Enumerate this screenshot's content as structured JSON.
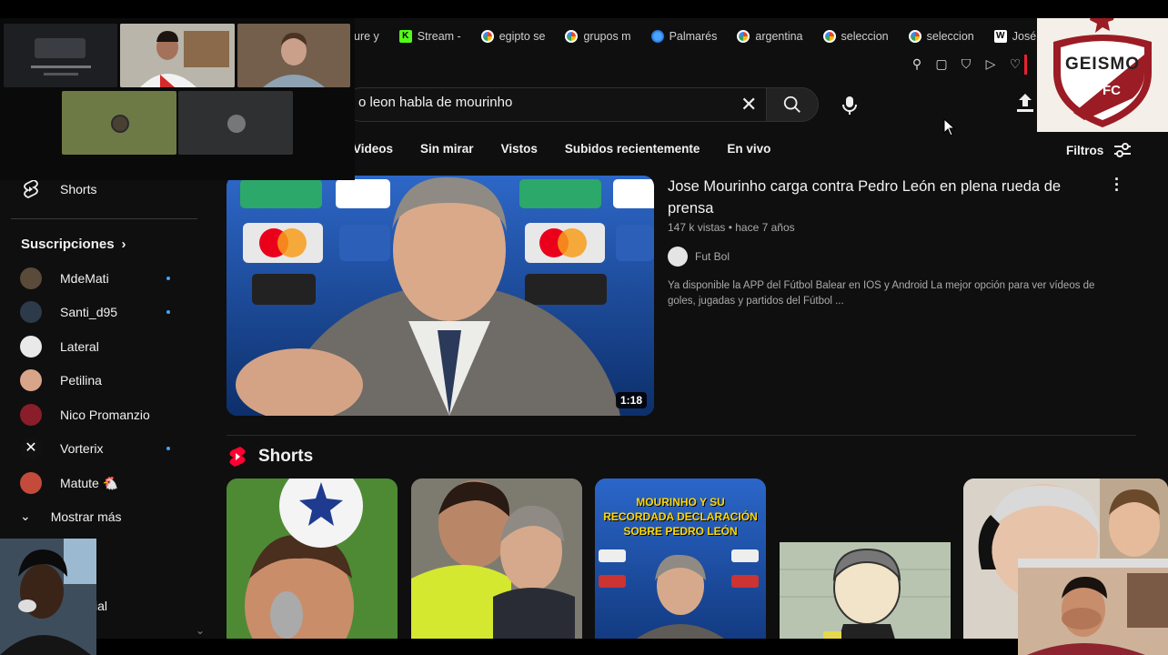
{
  "browser": {
    "tabs": [
      {
        "label": "ure y",
        "icon": "generic-tab-icon"
      },
      {
        "label": "Stream -",
        "icon": "kick-icon"
      },
      {
        "label": "egipto se",
        "icon": "google-icon"
      },
      {
        "label": "grupos m",
        "icon": "google-icon"
      },
      {
        "label": "Palmarés",
        "icon": "globe-icon"
      },
      {
        "label": "argentina",
        "icon": "google-icon"
      },
      {
        "label": "seleccion",
        "icon": "google-icon"
      },
      {
        "label": "seleccion",
        "icon": "google-icon"
      },
      {
        "label": "José Luis",
        "icon": "wikipedia-icon"
      }
    ],
    "new_tab": "+"
  },
  "search": {
    "query": "o leon habla de mourinho"
  },
  "filters": {
    "chips": [
      "Videos",
      "Sin mirar",
      "Vistos",
      "Subidos recientemente",
      "En vivo"
    ],
    "filtros_label": "Filtros"
  },
  "sidebar": {
    "shorts_label": "Shorts",
    "subscriptions_title": "Suscripciones",
    "subscriptions": [
      {
        "name": "MdeMati",
        "new": true,
        "color": "#5a4a3a"
      },
      {
        "name": "Santi_d95",
        "new": true,
        "color": "#2d3a4a"
      },
      {
        "name": "Lateral",
        "new": false,
        "color": "#e9e9e9"
      },
      {
        "name": "Petilina",
        "new": false,
        "color": "#d9a58a"
      },
      {
        "name": "Nico Promanzio",
        "new": false,
        "color": "#8a1d2a"
      },
      {
        "name": "Vorterix",
        "new": true,
        "color": "#111111"
      },
      {
        "name": "Matute 🐔",
        "new": false,
        "color": "#c44b3c"
      }
    ],
    "show_more": "Mostrar más",
    "partial_text": "ial"
  },
  "video": {
    "title": "Jose Mourinho carga contra Pedro León en plena rueda de prensa",
    "views": "147 k vistas",
    "age": "hace 7 años",
    "channel": "Fut Bol",
    "description": "Ya disponible la APP del Fútbol Balear en IOS y Android La mejor opción para ver vídeos de goles, jugadas y partidos del Fútbol ...",
    "duration": "1:18"
  },
  "shorts_shelf": {
    "title": "Shorts",
    "items": [
      {
        "overlay_text": ""
      },
      {
        "overlay_text": ""
      },
      {
        "overlay_text": "MOURINHO Y SU RECORDADA DECLARACIÓN SOBRE PEDRO LEÓN"
      },
      {
        "overlay_text": ""
      },
      {
        "overlay_text": ""
      }
    ]
  },
  "overlay": {
    "club_logo_text": "GEISMO",
    "club_logo_sub": "FC"
  },
  "colors": {
    "background": "#0f0f0f",
    "accent_red": "#ff0000",
    "link_blue": "#3ea6ff",
    "text_secondary": "#aaaaaa"
  }
}
